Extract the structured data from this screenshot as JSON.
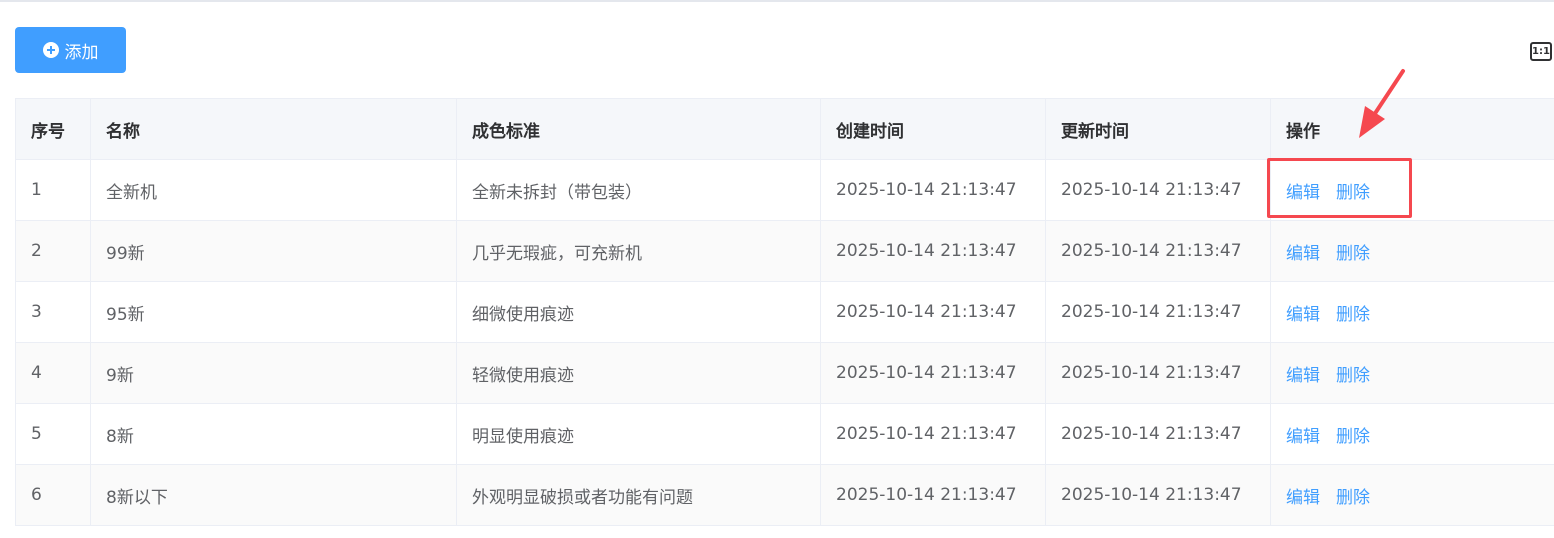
{
  "toolbar": {
    "add_label": "添加",
    "density_label": "1:1"
  },
  "table": {
    "columns": [
      "序号",
      "名称",
      "成色标准",
      "创建时间",
      "更新时间",
      "操作"
    ],
    "rows": [
      {
        "index": "1",
        "name": "全新机",
        "standard": "全新未拆封（带包装）",
        "created": "2025-10-14 21:13:47",
        "updated": "2025-10-14 21:13:47"
      },
      {
        "index": "2",
        "name": "99新",
        "standard": "几乎无瑕疵，可充新机",
        "created": "2025-10-14 21:13:47",
        "updated": "2025-10-14 21:13:47"
      },
      {
        "index": "3",
        "name": "95新",
        "standard": "细微使用痕迹",
        "created": "2025-10-14 21:13:47",
        "updated": "2025-10-14 21:13:47"
      },
      {
        "index": "4",
        "name": "9新",
        "standard": "轻微使用痕迹",
        "created": "2025-10-14 21:13:47",
        "updated": "2025-10-14 21:13:47"
      },
      {
        "index": "5",
        "name": "8新",
        "standard": "明显使用痕迹",
        "created": "2025-10-14 21:13:47",
        "updated": "2025-10-14 21:13:47"
      },
      {
        "index": "6",
        "name": "8新以下",
        "standard": "外观明显破损或者功能有问题",
        "created": "2025-10-14 21:13:47",
        "updated": "2025-10-14 21:13:47"
      }
    ],
    "edit_label": "编辑",
    "delete_label": "删除"
  },
  "colors": {
    "primary": "#409eff",
    "annotation": "#f5484f",
    "header_bg": "#f5f7fa"
  }
}
